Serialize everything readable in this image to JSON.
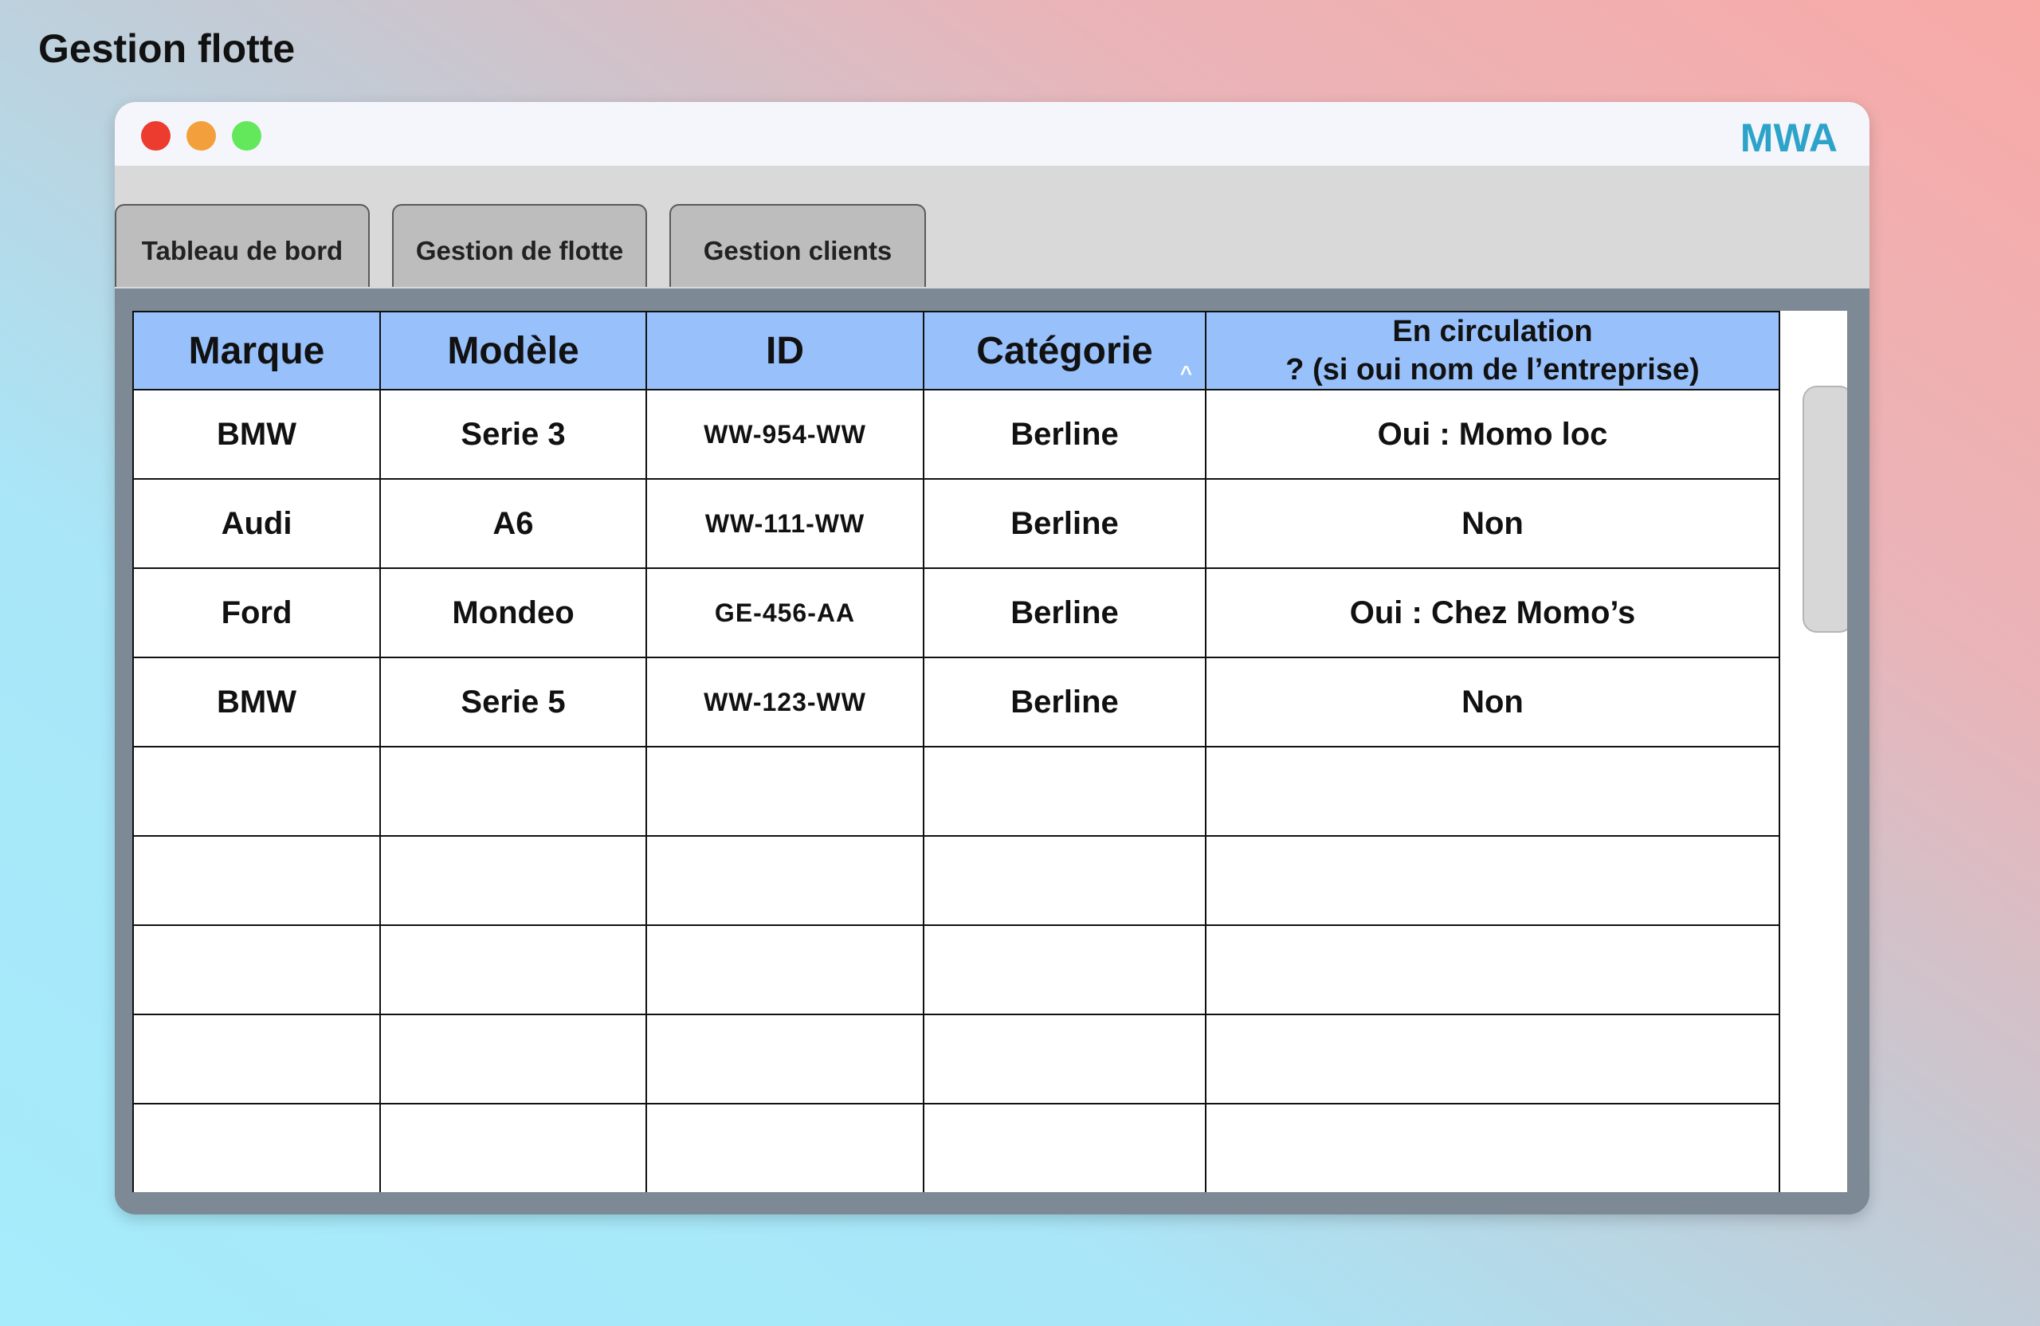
{
  "page": {
    "title": "Gestion flotte"
  },
  "window": {
    "brand": "MWA",
    "controls": [
      "close",
      "minimize",
      "maximize"
    ]
  },
  "tabs": [
    {
      "label": "Tableau de bord"
    },
    {
      "label": "Gestion de flotte"
    },
    {
      "label": "Gestion clients"
    }
  ],
  "table": {
    "columns": [
      {
        "label": "Marque"
      },
      {
        "label": "Modèle"
      },
      {
        "label": "ID"
      },
      {
        "label": "Catégorie",
        "sort_indicator": "^"
      },
      {
        "label_line1": "En circulation",
        "label_line2": "? (si oui nom de l’entreprise)"
      }
    ],
    "rows": [
      {
        "marque": "BMW",
        "modele": "Serie 3",
        "id": "WW-954-WW",
        "categorie": "Berline",
        "circulation": "Oui : Momo loc"
      },
      {
        "marque": "Audi",
        "modele": "A6",
        "id": "WW-111-WW",
        "categorie": "Berline",
        "circulation": "Non"
      },
      {
        "marque": "Ford",
        "modele": "Mondeo",
        "id": "GE-456-AA",
        "categorie": "Berline",
        "circulation": "Oui : Chez Momo’s"
      },
      {
        "marque": "BMW",
        "modele": "Serie 5",
        "id": "WW-123-WW",
        "categorie": "Berline",
        "circulation": "Non"
      }
    ]
  },
  "colors": {
    "header_bg": "#98c0fb",
    "brand": "#2ea3c9",
    "close": "#ec3b2f",
    "minimize": "#f3a03c",
    "maximize": "#63e85c"
  }
}
